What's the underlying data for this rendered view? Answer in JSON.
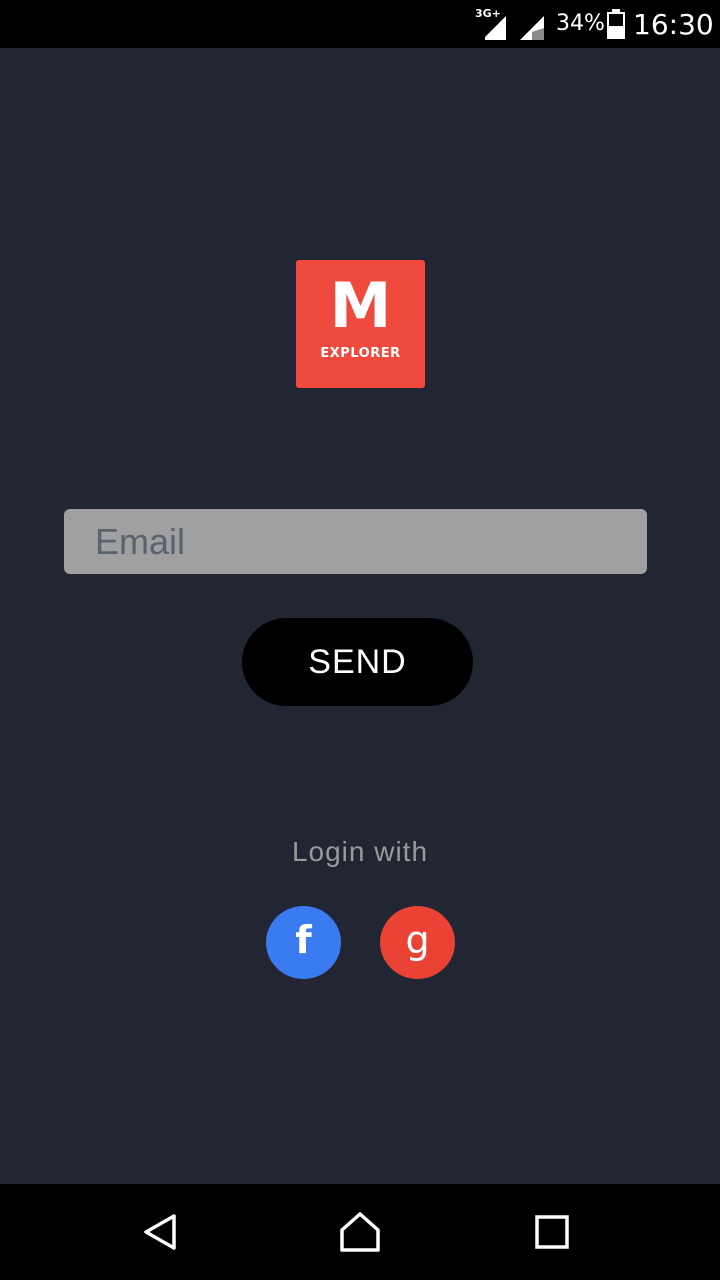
{
  "status_bar": {
    "network_label": "3G+",
    "battery_percent": "34%",
    "time": "16:30",
    "icons": [
      "signal-icon",
      "signal-icon",
      "battery-icon"
    ]
  },
  "logo": {
    "letter": "M",
    "word": "EXPLORER",
    "color": "#ef4a3d"
  },
  "form": {
    "email_placeholder": "Email",
    "email_value": "",
    "send_label": "SEND"
  },
  "social": {
    "login_with_label": "Login with",
    "facebook_glyph": "f",
    "google_glyph": "g",
    "facebook_color": "#3a7cf0",
    "google_color": "#ea4335"
  },
  "nav": {
    "icons": [
      "back-icon",
      "home-icon",
      "recent-apps-icon"
    ]
  }
}
